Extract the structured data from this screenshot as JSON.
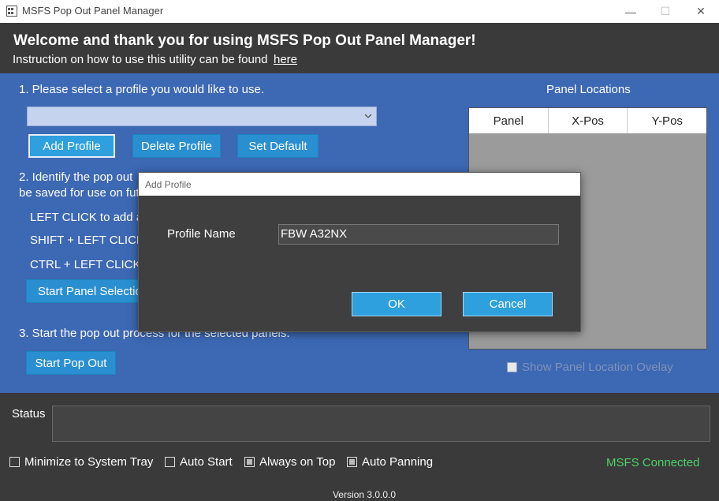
{
  "window": {
    "title": "MSFS Pop Out Panel Manager",
    "minimize_glyph": "—",
    "maximize_glyph": "☐",
    "close_glyph": "✕"
  },
  "header": {
    "welcome": "Welcome and thank you for using MSFS Pop Out Panel Manager!",
    "instruction": "Instruction on how to use this utility can be found",
    "link": "here"
  },
  "step1": {
    "label": "1. Please select a profile you would like to use.",
    "selected_profile": "",
    "add_profile": "Add Profile",
    "delete_profile": "Delete Profile",
    "set_default": "Set Default"
  },
  "step2": {
    "line1": "2. Identify the pop out",
    "line2": "be saved for use on fut",
    "left_click": "LEFT CLICK to add a",
    "shift_click": "SHIFT + LEFT CLICK t",
    "ctrl_click": "CTRL + LEFT CLICK w",
    "start_panel_selection": "Start Panel Selectio"
  },
  "step3": {
    "label": "3. Start the pop out process for the selected panels.",
    "start_pop_out": "Start Pop Out"
  },
  "panel_locations": {
    "title": "Panel Locations",
    "columns": [
      "Panel",
      "X-Pos",
      "Y-Pos"
    ],
    "show_overlay": "Show Panel Location Ovelay",
    "show_overlay_checked": false
  },
  "footer": {
    "status_label": "Status",
    "status_text": "",
    "options": [
      {
        "label": "Minimize to System Tray",
        "checked": false
      },
      {
        "label": "Auto Start",
        "checked": false
      },
      {
        "label": "Always on Top",
        "checked": true
      },
      {
        "label": "Auto Panning",
        "checked": true
      }
    ],
    "connection": "MSFS Connected",
    "version": "Version 3.0.0.0"
  },
  "dialog": {
    "title": "Add Profile",
    "field_label": "Profile Name",
    "field_value": "FBW A32NX",
    "ok": "OK",
    "cancel": "Cancel"
  },
  "colors": {
    "main_bg": "#3c68b4",
    "dark_bg": "#3a3a3a",
    "button": "#2ea0dd",
    "connected": "#4fd16a"
  }
}
